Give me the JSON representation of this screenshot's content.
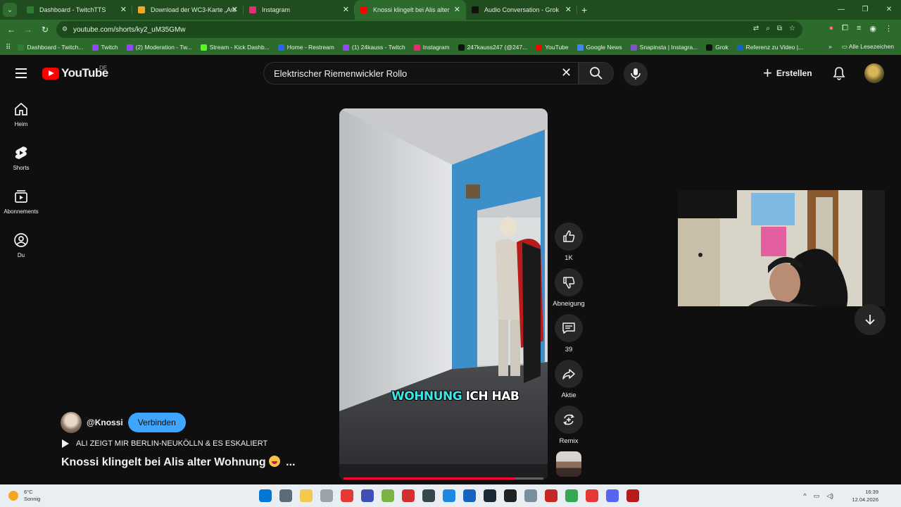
{
  "browser": {
    "tabs": [
      {
        "title": "Dashboard - TwitchTTS",
        "favicon_color": "#2e7d32",
        "active": false
      },
      {
        "title": "Download der WC3-Karte „Ani",
        "favicon_color": "#f5a623",
        "active": false
      },
      {
        "title": "Instagram",
        "favicon_color": "#e1306c",
        "active": false
      },
      {
        "title": "Knossi klingelt bei Alis alter",
        "favicon_color": "#ff0000",
        "active": true
      },
      {
        "title": "Audio Conversation - Grok",
        "favicon_color": "#111111",
        "active": false
      }
    ],
    "url": "youtube.com/shorts/ky2_uM35GMw",
    "bookmarks": [
      {
        "label": "Dashboard - Twitch...",
        "color": "#2e7d32"
      },
      {
        "label": "Twitch",
        "color": "#9146ff"
      },
      {
        "label": "(2) Moderation - Tw...",
        "color": "#9146ff"
      },
      {
        "label": "Stream - Kick Dashb...",
        "color": "#53fc18"
      },
      {
        "label": "Home - Restream",
        "color": "#2962ff"
      },
      {
        "label": "(1) 24kauss - Twitch",
        "color": "#9146ff"
      },
      {
        "label": "Instagram",
        "color": "#e1306c"
      },
      {
        "label": "247kauss247 (@247...",
        "color": "#111111"
      },
      {
        "label": "YouTube",
        "color": "#ff0000"
      },
      {
        "label": "Google News",
        "color": "#4285f4"
      },
      {
        "label": "Snapinsta | Instagra...",
        "color": "#7e57c2"
      },
      {
        "label": "Grok",
        "color": "#111111"
      },
      {
        "label": "Referenz zu Video |...",
        "color": "#1565c0"
      }
    ],
    "all_bookmarks_label": "Alle Lesezeichen",
    "overflow_label": "»"
  },
  "youtube": {
    "logo_text": "YouTube",
    "country_code": "DE",
    "search_value": "Elektrischer Riemenwickler Rollo",
    "create_label": "Erstellen",
    "sidebar": [
      {
        "label": "Heim",
        "icon": "home-icon"
      },
      {
        "label": "Shorts",
        "icon": "shorts-icon"
      },
      {
        "label": "Abonnements",
        "icon": "subscriptions-icon"
      },
      {
        "label": "Du",
        "icon": "you-icon"
      }
    ],
    "short": {
      "caption_highlight": "WOHNUNG",
      "caption_rest": "ICH HAB",
      "progress": 0.86,
      "likes": "1K",
      "dislike_label": "Abneigung",
      "comments": "39",
      "share_label": "Aktie",
      "remix_label": "Remix",
      "channel": "@Knossi",
      "subscribe_label": "Verbinden",
      "sound_title": "ALI ZEIGT MIR BERLIN-NEUKÖLLN & ES ESKALIERT",
      "title": "Knossi klingelt bei Alis alter Wohnung",
      "title_more": "..."
    }
  },
  "taskbar": {
    "weather_temp": "6°C",
    "weather_desc": "Sonnig",
    "time": "16:39",
    "date": "12.04.2026",
    "apps": [
      {
        "name": "windows-start-icon",
        "color": "#0078d4"
      },
      {
        "name": "calculator-icon",
        "color": "#5a6b7a"
      },
      {
        "name": "file-explorer-icon",
        "color": "#f2c94c"
      },
      {
        "name": "mouse-app-icon",
        "color": "#9aa3ab"
      },
      {
        "name": "red-app-icon",
        "color": "#e53935"
      },
      {
        "name": "v-app-icon",
        "color": "#3f51b5"
      },
      {
        "name": "bluestacks-icon",
        "color": "#7cb342"
      },
      {
        "name": "record-app-icon",
        "color": "#d32f2f"
      },
      {
        "name": "obs-icon",
        "color": "#37474f"
      },
      {
        "name": "stream-app-icon",
        "color": "#1e88e5"
      },
      {
        "name": "elgato-icon",
        "color": "#1565c0"
      },
      {
        "name": "steam-icon",
        "color": "#1b2838"
      },
      {
        "name": "terminal-icon",
        "color": "#212121"
      },
      {
        "name": "gear-app-icon",
        "color": "#78909c"
      },
      {
        "name": "voicemod-icon",
        "color": "#c62828"
      },
      {
        "name": "chrome-icon",
        "color": "#34a853"
      },
      {
        "name": "opera-icon",
        "color": "#e53935"
      },
      {
        "name": "discord-icon",
        "color": "#5865f2"
      },
      {
        "name": "voicemeeter-icon",
        "color": "#b71c1c"
      }
    ]
  }
}
